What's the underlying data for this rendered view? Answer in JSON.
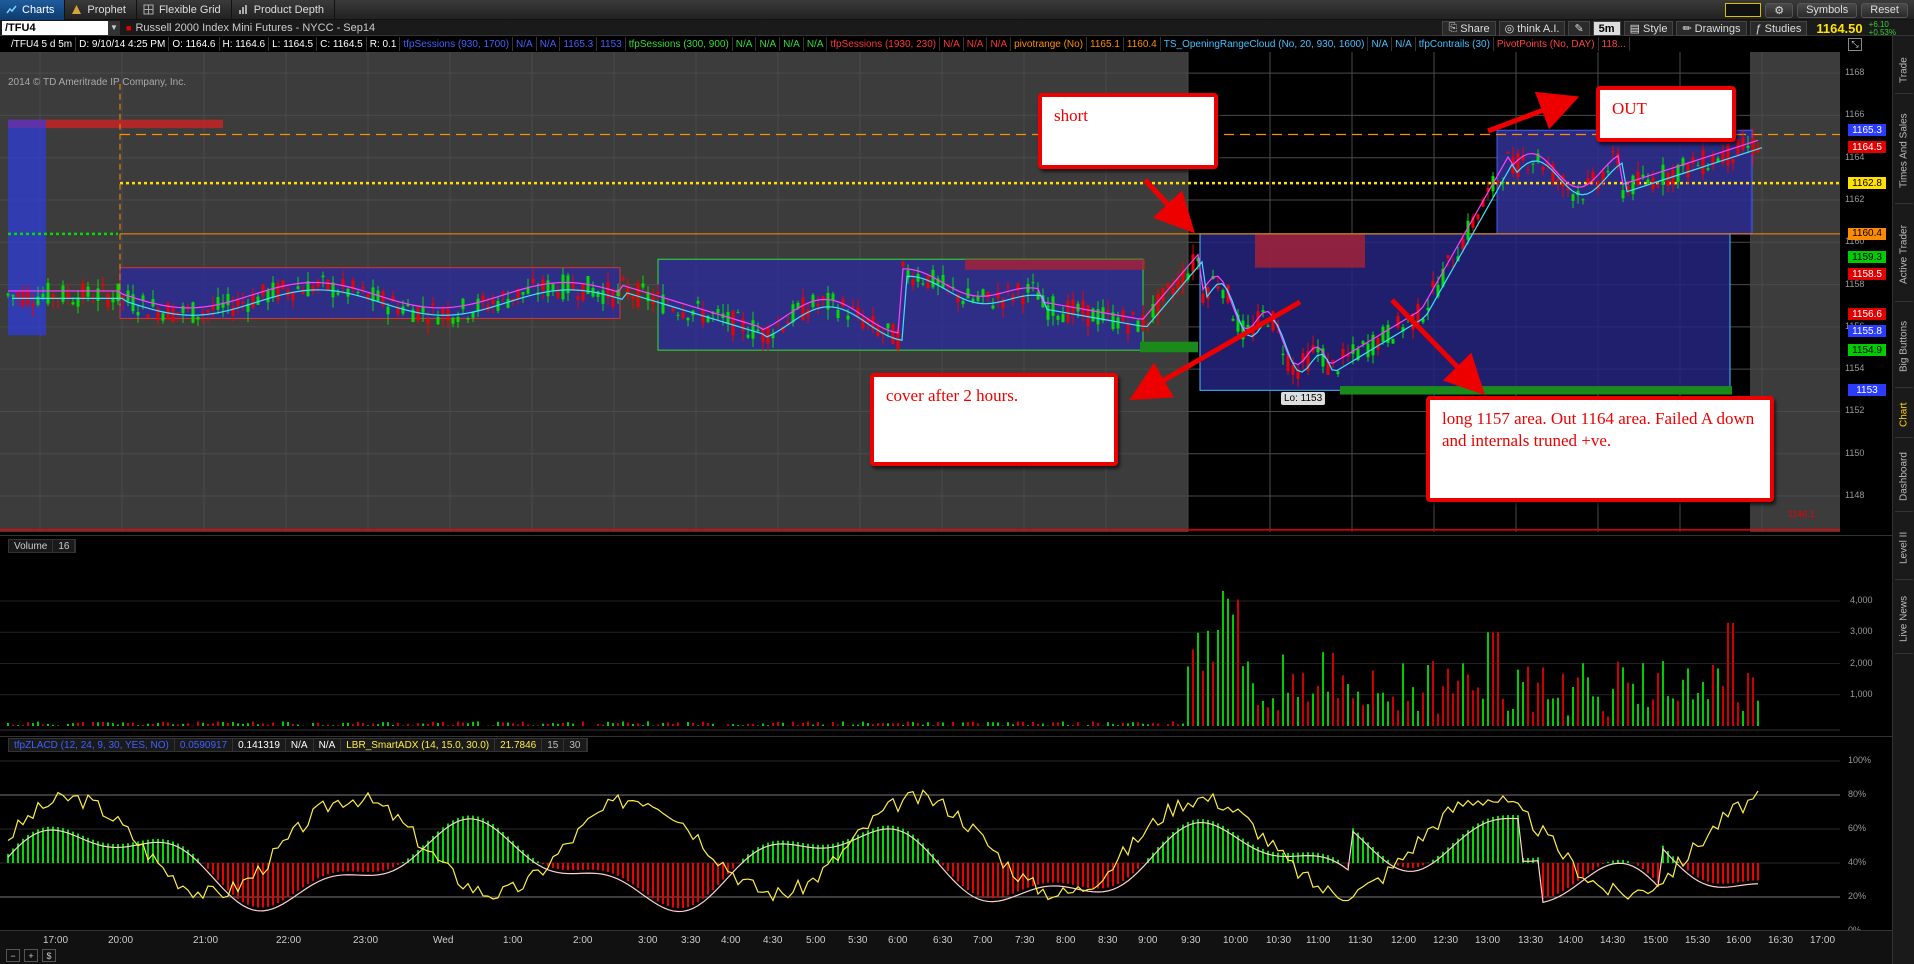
{
  "tabs": [
    {
      "label": "Charts",
      "icon": "charts-icon"
    },
    {
      "label": "Prophet",
      "icon": "prophet-icon"
    },
    {
      "label": "Flexible Grid",
      "icon": "grid-icon"
    },
    {
      "label": "Product Depth",
      "icon": "depth-icon"
    }
  ],
  "top_right": {
    "symbols": "Symbols",
    "reset": "Reset"
  },
  "symbol": {
    "value": "/TFU4",
    "description": "Russell 2000 Index Mini Futures - NYCC - Sep14"
  },
  "toolbar": {
    "share": "Share",
    "think": "think A.I.",
    "timeframe": "5m",
    "style": "Style",
    "drawings": "Drawings",
    "studies": "Studies",
    "last_price": "1164.50",
    "change_top": "+6.10",
    "change_bottom": "+0.53%"
  },
  "study_bar": [
    {
      "text": "/TFU4 5 d 5m",
      "color": "#ffffff"
    },
    {
      "text": "D: 9/10/14 4:25 PM",
      "color": "#ffffff"
    },
    {
      "text": "O: 1164.6",
      "color": "#ffffff"
    },
    {
      "text": "H: 1164.6",
      "color": "#ffffff"
    },
    {
      "text": "L: 1164.5",
      "color": "#ffffff"
    },
    {
      "text": "C: 1164.5",
      "color": "#ffffff"
    },
    {
      "text": "R: 0.1",
      "color": "#ffffff"
    },
    {
      "text": "tfpSessions (930, 1700)",
      "color": "#4060ff"
    },
    {
      "text": "N/A",
      "color": "#4060ff"
    },
    {
      "text": "N/A",
      "color": "#4060ff"
    },
    {
      "text": "1165.3",
      "color": "#4060ff"
    },
    {
      "text": "1153",
      "color": "#4060ff"
    },
    {
      "text": "tfpSessions (300, 900)",
      "color": "#33dd33"
    },
    {
      "text": "N/A",
      "color": "#33dd33"
    },
    {
      "text": "N/A",
      "color": "#33dd33"
    },
    {
      "text": "N/A",
      "color": "#33dd33"
    },
    {
      "text": "N/A",
      "color": "#33dd33"
    },
    {
      "text": "tfpSessions (1930, 230)",
      "color": "#ff3333"
    },
    {
      "text": "N/A",
      "color": "#ff3333"
    },
    {
      "text": "N/A",
      "color": "#ff3333"
    },
    {
      "text": "N/A",
      "color": "#ff3333"
    },
    {
      "text": "pivotrange (No)",
      "color": "#ff8c00"
    },
    {
      "text": "1165.1",
      "color": "#ff8c00"
    },
    {
      "text": "1160.4",
      "color": "#ff8c00"
    },
    {
      "text": "TS_OpeningRangeCloud (No, 20, 930, 1600)",
      "color": "#40c0ff"
    },
    {
      "text": "N/A",
      "color": "#40c0ff"
    },
    {
      "text": "N/A",
      "color": "#40c0ff"
    },
    {
      "text": "tfpContrails (30)",
      "color": "#40c0ff"
    },
    {
      "text": "PivotPoints (No, DAY)",
      "color": "#ff4040"
    },
    {
      "text": "118...",
      "color": "#ff4040"
    }
  ],
  "watermark": "2014 © TD Ameritrade IP Company, Inc.",
  "price_axis": [
    "1168",
    "1166",
    "1164",
    "1162",
    "1160",
    "1158",
    "1156",
    "1154",
    "1152",
    "1150",
    "1148"
  ],
  "price_badges": [
    {
      "text": "1165.3",
      "bg": "#2a3cff",
      "fg": "#ffffff",
      "price": 1165.3
    },
    {
      "text": "1164.5",
      "bg": "#e00000",
      "fg": "#ffffff",
      "price": 1164.5
    },
    {
      "text": "1162.8",
      "bg": "#ffe000",
      "fg": "#000000",
      "price": 1162.8
    },
    {
      "text": "1160.4",
      "bg": "#ff8c00",
      "fg": "#000000",
      "price": 1160.4
    },
    {
      "text": "1159.3",
      "bg": "#00cc00",
      "fg": "#000000",
      "price": 1159.3
    },
    {
      "text": "1158.5",
      "bg": "#e00000",
      "fg": "#ffffff",
      "price": 1158.5
    },
    {
      "text": "1156.6",
      "bg": "#e00000",
      "fg": "#ffffff",
      "price": 1156.6
    },
    {
      "text": "1155.8",
      "bg": "#2a3cff",
      "fg": "#ffffff",
      "price": 1155.8
    },
    {
      "text": "1154.9",
      "bg": "#00cc00",
      "fg": "#000000",
      "price": 1154.9
    },
    {
      "text": "1153",
      "bg": "#2a3cff",
      "fg": "#ffffff",
      "price": 1153.0
    }
  ],
  "pivot_low_label": "1146.1",
  "lo_label": "Lo: 1153",
  "annotations": {
    "short": "short",
    "out": "OUT",
    "cover": "cover after 2 hours.",
    "long": "long 1157 area. Out 1164 area. Failed A down and internals truned +ve."
  },
  "volume_pane": {
    "label": "Volume",
    "value": "16",
    "axis": [
      "4,000",
      "3,000",
      "2,000",
      "1,000"
    ]
  },
  "osc_pane": {
    "labels": [
      {
        "text": "tfpZLACD (12, 24, 9, 30, YES, NO)",
        "color": "#4060ff"
      },
      {
        "text": "0.0590917",
        "color": "#4060ff"
      },
      {
        "text": "0.141319",
        "color": "#ffffff"
      },
      {
        "text": "N/A",
        "color": "#ffffff"
      },
      {
        "text": "N/A",
        "color": "#ffffff"
      },
      {
        "text": "LBR_SmartADX (14, 15.0, 30.0)",
        "color": "#ffee44"
      },
      {
        "text": "21.7846",
        "color": "#ffee44"
      },
      {
        "text": "15",
        "color": "#bbbbbb"
      },
      {
        "text": "30",
        "color": "#bbbbbb"
      }
    ],
    "axis": [
      "100%",
      "80%",
      "60%",
      "40%",
      "20%",
      "0%"
    ]
  },
  "time_axis": [
    "17:00",
    "20:00",
    "21:00",
    "22:00",
    "23:00",
    "Wed",
    "1:00",
    "2:00",
    "3:00",
    "3:30",
    "4:00",
    "4:30",
    "5:00",
    "5:30",
    "6:00",
    "6:30",
    "7:00",
    "7:30",
    "8:00",
    "8:30",
    "9:00",
    "9:30",
    "10:00",
    "10:30",
    "11:00",
    "11:30",
    "12:00",
    "12:30",
    "13:00",
    "13:30",
    "14:00",
    "14:30",
    "15:00",
    "15:30",
    "16:00",
    "16:30",
    "17:00"
  ],
  "right_tabs": [
    "Trade",
    "Times And Sales",
    "Active Trader",
    "Big Buttons",
    "Chart",
    "Dashboard",
    "Level II",
    "Live News"
  ],
  "active_right_tab": "Chart",
  "colors": {
    "accent_blue": "#1f5c9c",
    "up": "#00dd00",
    "down": "#ee0000",
    "annotation_red": "#e00000"
  }
}
